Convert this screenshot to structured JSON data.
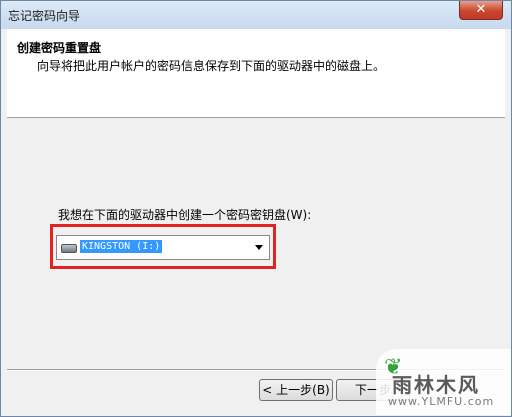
{
  "window": {
    "title": "忘记密码向导",
    "close_label": "✕"
  },
  "header": {
    "title": "创建密码重置盘",
    "description": "向导将把此用户帐户的密码信息保存到下面的驱动器中的磁盘上。"
  },
  "main": {
    "prompt": "我想在下面的驱动器中创建一个密码密钥盘(W):",
    "drive_select": {
      "selected": "KINGSTON (I:)",
      "icon": "usb-drive-icon"
    }
  },
  "footer": {
    "back_label": "< 上一步(B)",
    "next_label": "下一步"
  },
  "watermark": {
    "text": "雨林木风",
    "url": "www.YLMFU.com"
  },
  "colors": {
    "highlight_box": "#e02424",
    "selection": "#3399ff",
    "close_button": "#c9462c"
  }
}
